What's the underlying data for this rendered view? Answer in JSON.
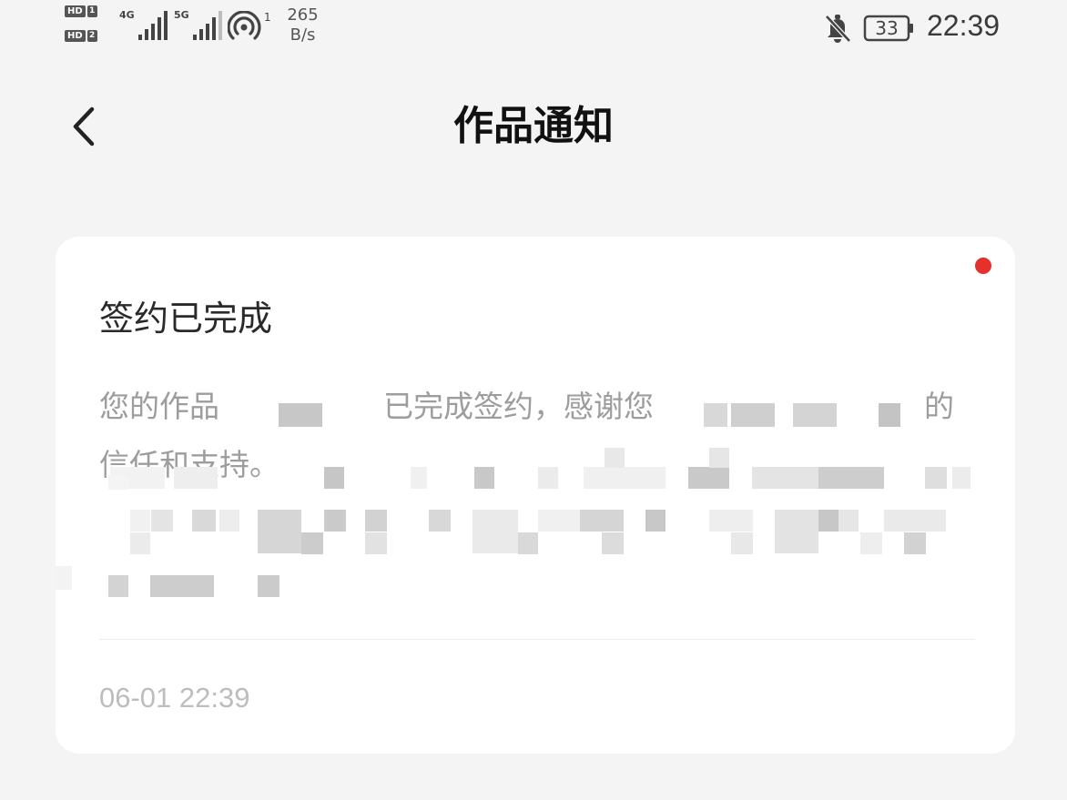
{
  "status_bar": {
    "sim1": {
      "chip": "HD",
      "num": "1"
    },
    "sim2": {
      "chip": "HD",
      "num": "2"
    },
    "sim1_tech": "4G",
    "sim2_tech": "5G",
    "hotspot_count": "1",
    "speed_value": "265",
    "speed_unit": "B/s",
    "battery": "33",
    "time": "22:39",
    "icons": [
      "signal-icon",
      "hotspot-icon",
      "mute-bell-icon",
      "battery-icon"
    ]
  },
  "header": {
    "back_icon": "chevron-left-icon",
    "title": "作品通知"
  },
  "notification": {
    "title": "签约已完成",
    "body_part1": "您的作品",
    "body_part2": "已完成签约，感谢您",
    "body_part3": "的",
    "body_line2": "信任和支持。",
    "time": "06-01 22:39",
    "unread": true,
    "unread_color": "#e5302c"
  }
}
